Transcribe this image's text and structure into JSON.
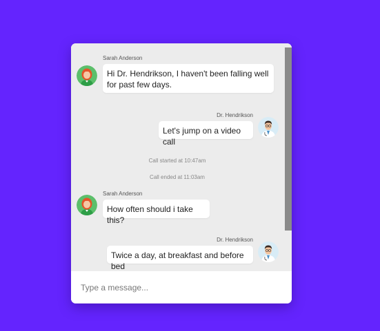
{
  "conversation": {
    "messages": [
      {
        "sender": "Sarah Anderson",
        "text": "Hi Dr. Hendrikson, I haven't been falling well for past few days.",
        "side": "left",
        "avatar": "patient-avatar-icon"
      },
      {
        "sender": "Dr. Hendrikson",
        "text": "Let's jump on a video call",
        "side": "right",
        "avatar": "doctor-avatar-icon"
      },
      {
        "sender": "Sarah Anderson",
        "text": "How often should i take this?",
        "side": "left",
        "avatar": "patient-avatar-icon"
      },
      {
        "sender": "Dr. Hendrikson",
        "text": "Twice a day, at breakfast and before bed",
        "side": "right",
        "avatar": "doctor-avatar-icon"
      }
    ],
    "system_notes": [
      "Call started at 10:47am",
      "Call ended at 11:03am"
    ]
  },
  "composer": {
    "placeholder": "Type a message..."
  },
  "colors": {
    "page_background": "#6424fe",
    "chat_background": "#ececec",
    "bubble": "#ffffff",
    "scrollbar_thumb": "#8a8a8a",
    "patient_avatar_bg": "#5cbf6b",
    "doctor_avatar_bg": "#d8ecf6"
  }
}
